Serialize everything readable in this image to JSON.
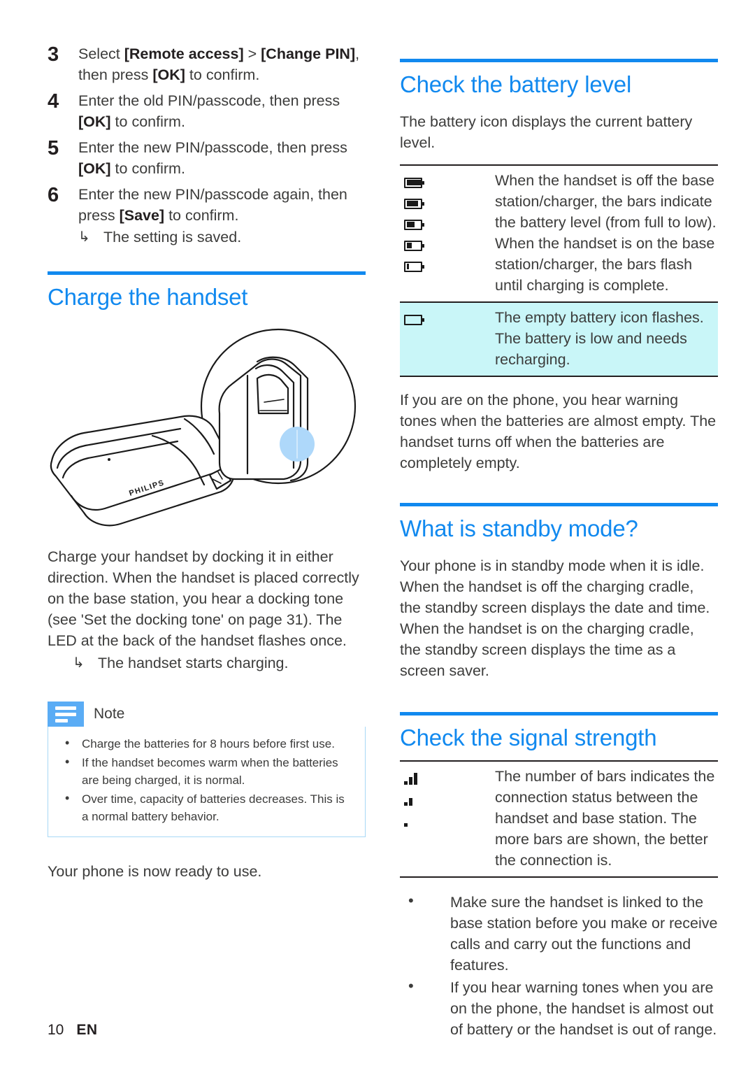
{
  "colors": {
    "heading_blue": "#1189ef",
    "rule_blue": "#1189ef",
    "note_tab_blue": "#5aacf5",
    "note_border_blue": "#a8d8f5",
    "highlight_cyan": "#c9f6f8",
    "illustration_dot_blue": "#aed8fa",
    "body_text": "#3c3c3b"
  },
  "left_column": {
    "steps": [
      {
        "number": "3",
        "segments": [
          {
            "text": "Select ",
            "bold": false
          },
          {
            "text": "[Remote access]",
            "bold": true
          },
          {
            "text": " > ",
            "bold": false
          },
          {
            "text": "[Change PIN]",
            "bold": true
          },
          {
            "text": ", then press ",
            "bold": false
          },
          {
            "text": "[OK]",
            "bold": true
          },
          {
            "text": " to confirm.",
            "bold": false
          }
        ]
      },
      {
        "number": "4",
        "segments": [
          {
            "text": "Enter the old PIN/passcode, then press ",
            "bold": false
          },
          {
            "text": "[OK]",
            "bold": true
          },
          {
            "text": " to confirm.",
            "bold": false
          }
        ]
      },
      {
        "number": "5",
        "segments": [
          {
            "text": "Enter the new PIN/passcode, then press ",
            "bold": false
          },
          {
            "text": "[OK]",
            "bold": true
          },
          {
            "text": " to confirm.",
            "bold": false
          }
        ]
      },
      {
        "number": "6",
        "segments": [
          {
            "text": "Enter the new PIN/passcode again, then press ",
            "bold": false
          },
          {
            "text": "[Save]",
            "bold": true
          },
          {
            "text": " to confirm.",
            "bold": false
          }
        ],
        "substep": {
          "arrow": "↳",
          "text": "The setting is saved."
        }
      }
    ],
    "charge_section": {
      "heading": "Charge the handset",
      "illustration_alt": "Cordless handset docked on its base station, line drawing with PHILIPS branding and a blue circular highlight",
      "illustration_brand": "PHILIPS",
      "paragraph": "Charge your handset by docking it in either direction. When the handset is placed correctly on the base station, you hear a docking tone (see 'Set the docking tone' on page 31). The LED at the back of the handset flashes once.",
      "substep": {
        "arrow": "↳",
        "text": "The handset starts charging."
      }
    },
    "note": {
      "title": "Note",
      "items": [
        "Charge the batteries for 8 hours before first use.",
        "If the handset becomes warm when the batteries are being charged, it is normal.",
        "Over time, capacity of batteries decreases. This is a normal battery behavior."
      ]
    },
    "closing_paragraph": "Your phone is now ready to use."
  },
  "right_column": {
    "battery_section": {
      "heading": "Check the battery level",
      "intro": "The battery icon displays the current battery level.",
      "rows": [
        {
          "icons": [
            {
              "name": "battery-full-icon",
              "fill_percent": 100
            },
            {
              "name": "battery-high-icon",
              "fill_percent": 80
            },
            {
              "name": "battery-medium-icon",
              "fill_percent": 55
            },
            {
              "name": "battery-low-icon",
              "fill_percent": 35
            },
            {
              "name": "battery-very-low-icon",
              "fill_percent": 18
            }
          ],
          "text": "When the handset is off the base station/charger, the bars indicate the battery level (from full to low). When the handset is on the base station/charger, the bars flash until charging is complete.",
          "highlighted": false
        },
        {
          "icons": [
            {
              "name": "battery-empty-icon",
              "fill_percent": 0
            }
          ],
          "text": "The empty battery icon flashes. The battery is low and needs recharging.",
          "highlighted": true
        }
      ],
      "after_table_paragraph": "If you are on the phone, you hear warning tones when the batteries are almost empty. The handset turns off when the batteries are completely empty."
    },
    "standby_section": {
      "heading": "What is standby mode?",
      "paragraph": "Your phone is in standby mode when it is idle. When the handset is off the charging cradle, the standby screen displays the date and time. When the handset is on the charging cradle, the standby screen displays the time as a screen saver."
    },
    "signal_section": {
      "heading": "Check the signal strength",
      "rows": [
        {
          "icons": [
            {
              "name": "signal-three-bars-icon",
              "bars": 3
            },
            {
              "name": "signal-two-bars-icon",
              "bars": 2
            },
            {
              "name": "signal-one-bar-icon",
              "bars": 1
            }
          ],
          "text": "The number of bars indicates the connection status between the handset and base station. The more bars are shown, the better the connection is."
        }
      ],
      "bullets": [
        "Make sure the handset is linked to the base station before you make or receive calls and carry out the functions and features.",
        "If you hear warning tones when you are on the phone, the handset is almost out of battery or the handset is out of range."
      ]
    }
  },
  "footer": {
    "page_number": "10",
    "language": "EN"
  }
}
